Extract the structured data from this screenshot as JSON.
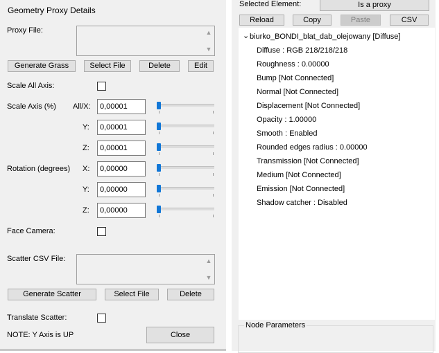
{
  "left": {
    "title": "Geometry Proxy Details",
    "proxy_file_label": "Proxy File:",
    "proxy_buttons": [
      "Generate Grass",
      "Select File",
      "Delete",
      "Edit"
    ],
    "scale_all_label": "Scale All Axis:",
    "scale_axis_label": "Scale Axis (%)",
    "rotation_label": "Rotation (degrees)",
    "axis_labels": [
      "All/X:",
      "Y:",
      "Z:",
      "X:",
      "Y:",
      "Z:"
    ],
    "scale_values": [
      "0,00001",
      "0,00001",
      "0,00001"
    ],
    "rotation_values": [
      "0,00000",
      "0,00000",
      "0,00000"
    ],
    "face_camera_label": "Face Camera:",
    "scatter_csv_label": "Scatter CSV File:",
    "scatter_buttons": [
      "Generate Scatter",
      "Select File",
      "Delete"
    ],
    "translate_scatter_label": "Translate Scatter:",
    "note": "NOTE: Y Axis is UP",
    "close_label": "Close"
  },
  "right": {
    "selected_label": "Selected Element:",
    "is_proxy_label": "Is a proxy",
    "buttons": {
      "reload": "Reload",
      "copy": "Copy",
      "paste": "Paste",
      "csv": "CSV"
    },
    "tree_root": "biurko_BONDI_blat_dab_olejowany  [Diffuse]",
    "tree_items": [
      "Diffuse : RGB 218/218/218",
      "Roughness : 0.00000",
      "Bump  [Not Connected]",
      "Normal  [Not Connected]",
      "Displacement  [Not Connected]",
      "Opacity : 1.00000",
      "Smooth : Enabled",
      "Rounded edges radius : 0.00000",
      "Transmission  [Not Connected]",
      "Medium  [Not Connected]",
      "Emission  [Not Connected]",
      "Shadow catcher : Disabled"
    ],
    "node_params_label": "Node Parameters"
  },
  "colors": {
    "accent": "#1177d7",
    "panel": "#f0f0f0",
    "button": "#e1e1e1"
  }
}
